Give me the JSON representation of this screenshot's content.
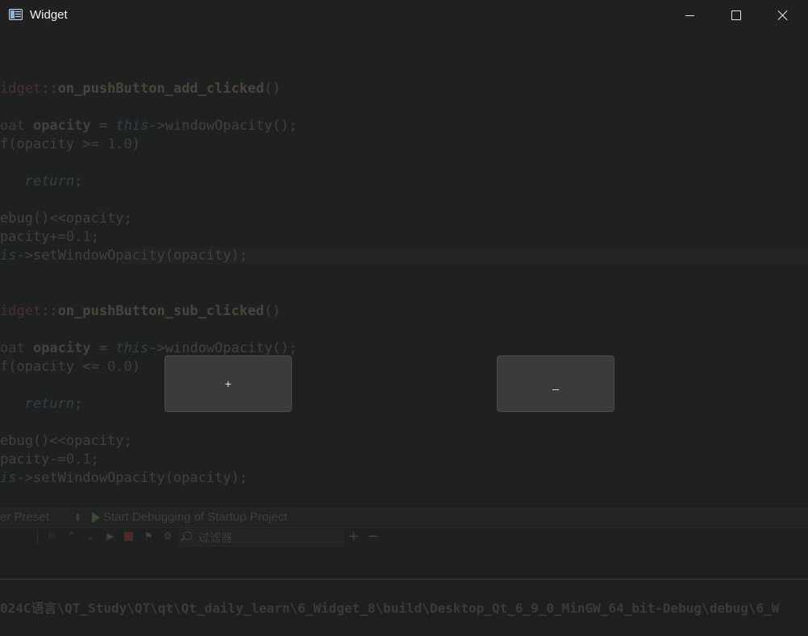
{
  "window": {
    "title": "Widget"
  },
  "code_lines": [
    {
      "parts": []
    },
    {
      "parts": [
        {
          "t": "idget",
          "c": "cls"
        },
        {
          "t": "::",
          "c": "plain"
        },
        {
          "t": "on_pushButton_add_clicked",
          "c": "fn"
        },
        {
          "t": "()",
          "c": "plain"
        }
      ]
    },
    {
      "parts": []
    },
    {
      "parts": [
        {
          "t": "oat ",
          "c": "type"
        },
        {
          "t": "opacity",
          "c": "var"
        },
        {
          "t": " = ",
          "c": "plain"
        },
        {
          "t": "this",
          "c": "kw"
        },
        {
          "t": "->windowOpacity();",
          "c": "plain"
        }
      ]
    },
    {
      "parts": [
        {
          "t": "f(opacity >= ",
          "c": "plain"
        },
        {
          "t": "1.0",
          "c": "num"
        },
        {
          "t": ")",
          "c": "plain"
        }
      ]
    },
    {
      "parts": []
    },
    {
      "parts": [
        {
          "t": "   ",
          "c": "plain"
        },
        {
          "t": "return",
          "c": "kw"
        },
        {
          "t": ";",
          "c": "plain"
        }
      ]
    },
    {
      "parts": []
    },
    {
      "parts": [
        {
          "t": "ebug()<<opacity;",
          "c": "plain"
        }
      ]
    },
    {
      "parts": [
        {
          "t": "pacity+=",
          "c": "plain"
        },
        {
          "t": "0.1",
          "c": "num"
        },
        {
          "t": ";",
          "c": "plain"
        }
      ]
    },
    {
      "parts": [
        {
          "t": "is",
          "c": "kw"
        },
        {
          "t": "->setWindowOpacity(opacity);",
          "c": "plain"
        }
      ]
    },
    {
      "parts": []
    },
    {
      "parts": []
    },
    {
      "parts": [
        {
          "t": "idget",
          "c": "cls"
        },
        {
          "t": "::",
          "c": "plain"
        },
        {
          "t": "on_pushButton_sub_clicked",
          "c": "fn"
        },
        {
          "t": "()",
          "c": "plain"
        }
      ]
    },
    {
      "parts": []
    },
    {
      "parts": [
        {
          "t": "oat ",
          "c": "type"
        },
        {
          "t": "opacity",
          "c": "var"
        },
        {
          "t": " = ",
          "c": "plain"
        },
        {
          "t": "this",
          "c": "kw"
        },
        {
          "t": "->windowOpacity();",
          "c": "plain"
        }
      ]
    },
    {
      "parts": [
        {
          "t": "f(opacity <= ",
          "c": "plain"
        },
        {
          "t": "0.0",
          "c": "num"
        },
        {
          "t": ")",
          "c": "plain"
        }
      ]
    },
    {
      "parts": []
    },
    {
      "parts": [
        {
          "t": "   ",
          "c": "plain"
        },
        {
          "t": "return",
          "c": "kw"
        },
        {
          "t": ";",
          "c": "plain"
        }
      ]
    },
    {
      "parts": []
    },
    {
      "parts": [
        {
          "t": "ebug()<<opacity;",
          "c": "plain"
        }
      ]
    },
    {
      "parts": [
        {
          "t": "pacity-=",
          "c": "plain"
        },
        {
          "t": "0.1",
          "c": "num"
        },
        {
          "t": ";",
          "c": "plain"
        }
      ]
    },
    {
      "parts": [
        {
          "t": "is",
          "c": "kw"
        },
        {
          "t": "->setWindowOpacity(opacity);",
          "c": "plain"
        }
      ]
    }
  ],
  "buttons": {
    "add_label": "+",
    "sub_label": "_"
  },
  "status_bar": {
    "preset_label": "er Preset",
    "debug_label": "Start Debugging of Startup Project"
  },
  "toolbar": {
    "filter_placeholder": "过滤器",
    "add_glyph": "+",
    "remove_glyph": "−"
  },
  "output_path": "024C语言\\QT_Study\\QT\\qt\\Qt_daily_learn\\6_Widget_8\\build\\Desktop_Qt_6_9_0_MinGW_64_bit-Debug\\debug\\6_W"
}
